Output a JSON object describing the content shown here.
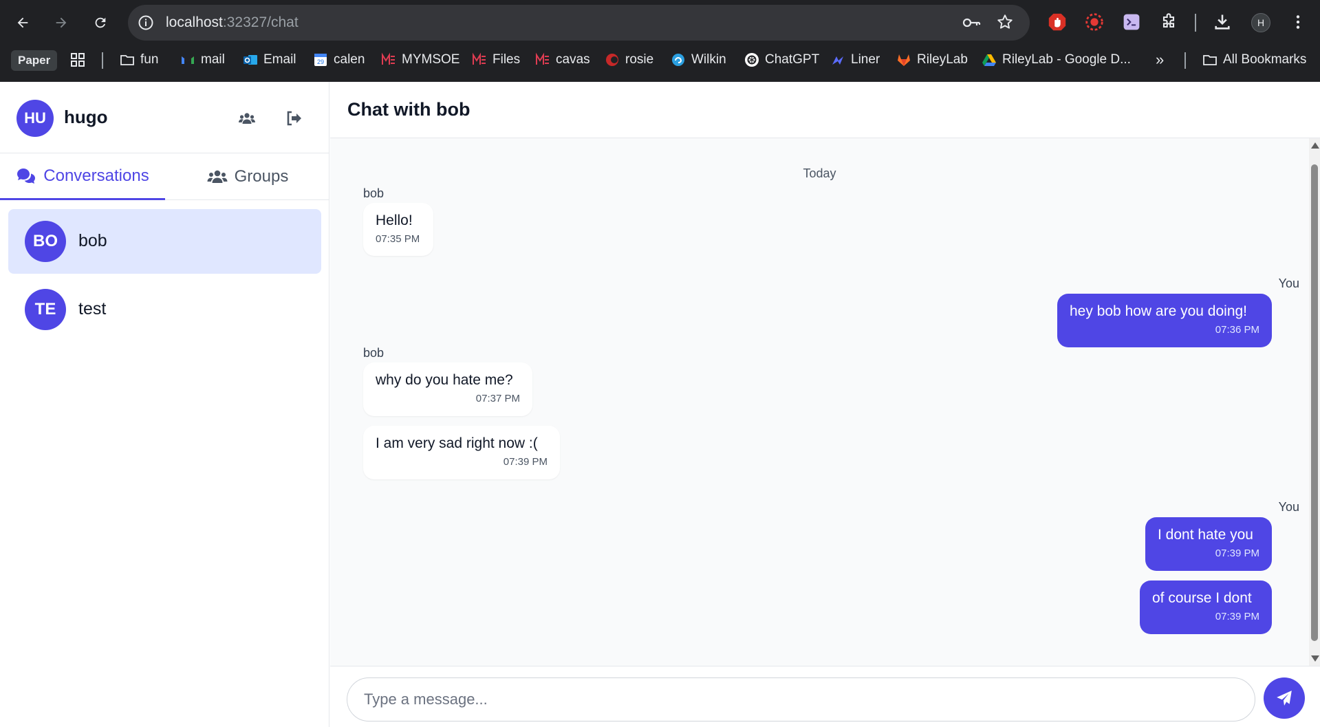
{
  "browser": {
    "url_host": "localhost",
    "url_path": ":32327/chat",
    "profile_initial": "H",
    "icons": [
      "back-icon",
      "forward-icon",
      "reload-icon",
      "site-info-icon",
      "password-key-icon",
      "bookmark-star-icon",
      "adblock-extension-icon",
      "record-extension-icon",
      "terminal-extension-icon",
      "extensions-puzzle-icon",
      "download-icon",
      "more-menu-icon"
    ]
  },
  "bookmarks": {
    "paper_label": "Paper",
    "items": [
      {
        "label": "fun",
        "icon": "folder-icon"
      },
      {
        "label": "mail",
        "icon": "gmail-icon"
      },
      {
        "label": "Email",
        "icon": "outlook-icon"
      },
      {
        "label": "calen",
        "icon": "calendar-icon"
      },
      {
        "label": "MYMSOE",
        "icon": "msoe-icon"
      },
      {
        "label": "Files",
        "icon": "msoe-icon"
      },
      {
        "label": "cavas",
        "icon": "msoe-icon"
      },
      {
        "label": "rosie",
        "icon": "rosie-icon"
      },
      {
        "label": "Wilkin",
        "icon": "wilkin-icon"
      },
      {
        "label": "ChatGPT",
        "icon": "chatgpt-icon"
      },
      {
        "label": "Liner",
        "icon": "liner-icon"
      },
      {
        "label": "RileyLab",
        "icon": "gitlab-icon"
      },
      {
        "label": "RileyLab - Google D...",
        "icon": "google-drive-icon"
      }
    ],
    "overflow_label": "»",
    "all_bookmarks_label": "All Bookmarks"
  },
  "sidebar": {
    "user": {
      "initials": "HU",
      "name": "hugo"
    },
    "tabs": [
      {
        "label": "Conversations",
        "active": true
      },
      {
        "label": "Groups",
        "active": false
      }
    ],
    "conversations": [
      {
        "initials": "BO",
        "name": "bob",
        "active": true
      },
      {
        "initials": "TE",
        "name": "test",
        "active": false
      }
    ]
  },
  "chat": {
    "title": "Chat with bob",
    "day_separator": "Today",
    "messages": [
      {
        "sender": "bob",
        "text": "Hello!",
        "time": "07:35 PM",
        "outgoing": false
      },
      {
        "sender": "You",
        "text": "hey bob how are you doing!",
        "time": "07:36 PM",
        "outgoing": true
      },
      {
        "sender": "bob",
        "text": "why do you hate me?",
        "time": "07:37 PM",
        "outgoing": false
      },
      {
        "sender": "",
        "text": "I am very sad right now :(",
        "time": "07:39 PM",
        "outgoing": false
      },
      {
        "sender": "You",
        "text": "I dont hate you",
        "time": "07:39 PM",
        "outgoing": true
      },
      {
        "sender": "",
        "text": "of course I dont",
        "time": "07:39 PM",
        "outgoing": true
      }
    ],
    "composer_placeholder": "Type a message..."
  },
  "colors": {
    "accent": "#4f46e5",
    "accent_light": "#e0e7ff",
    "chrome_bg": "#202124",
    "chat_bg": "#f9fafb"
  }
}
